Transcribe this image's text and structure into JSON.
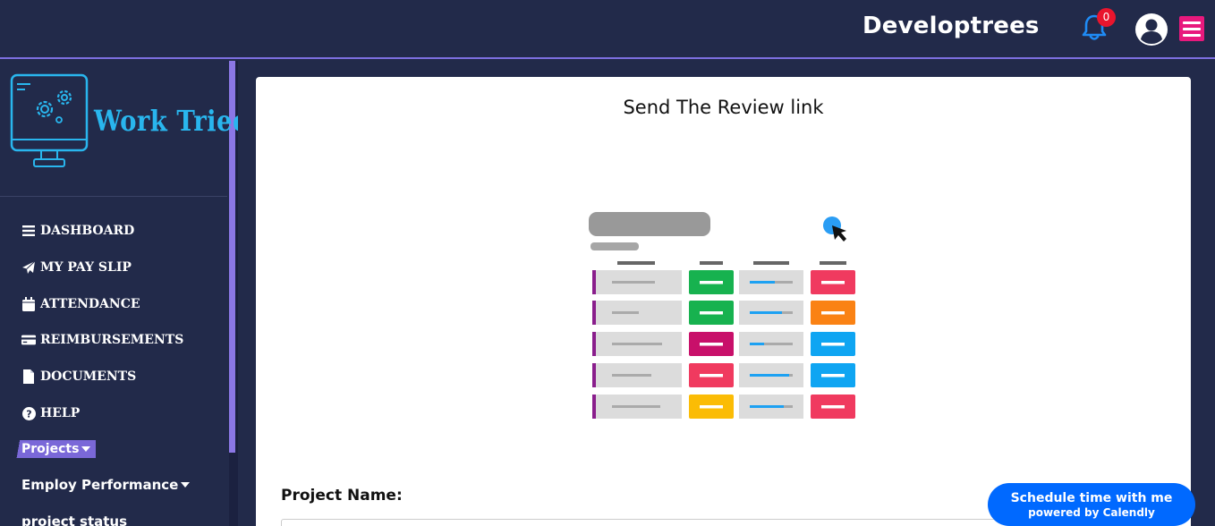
{
  "header": {
    "brand": "Developtrees",
    "notifications_count": "0",
    "bell_icon": "bell-icon",
    "user_icon": "user-circle-icon",
    "menu_icon": "hamburger-menu-icon",
    "accent_color": "#e8197d",
    "badge_color": "#e9152d"
  },
  "sidebar": {
    "logo_text": "Work Tried",
    "items": [
      {
        "label": "DASHBOARD",
        "icon": "bars-icon"
      },
      {
        "label": "MY PAY SLIP",
        "icon": "paper-plane-icon"
      },
      {
        "label": "ATTENDANCE",
        "icon": "calendar-icon"
      },
      {
        "label": "REIMBURSEMENTS",
        "icon": "credit-card-icon"
      },
      {
        "label": "DOCUMENTS",
        "icon": "file-icon"
      },
      {
        "label": "HELP",
        "icon": "question-circle-icon"
      }
    ],
    "projects_label": "Projects",
    "employ_performance_label": "Employ Performance",
    "project_status_label": "project status"
  },
  "main": {
    "title": "Send The Review link",
    "project_name_label": "Project Name:",
    "project_name_value": ""
  },
  "calendly": {
    "title": "Schedule time with me",
    "subtitle": "powered by Calendly",
    "color": "#0069ff"
  }
}
